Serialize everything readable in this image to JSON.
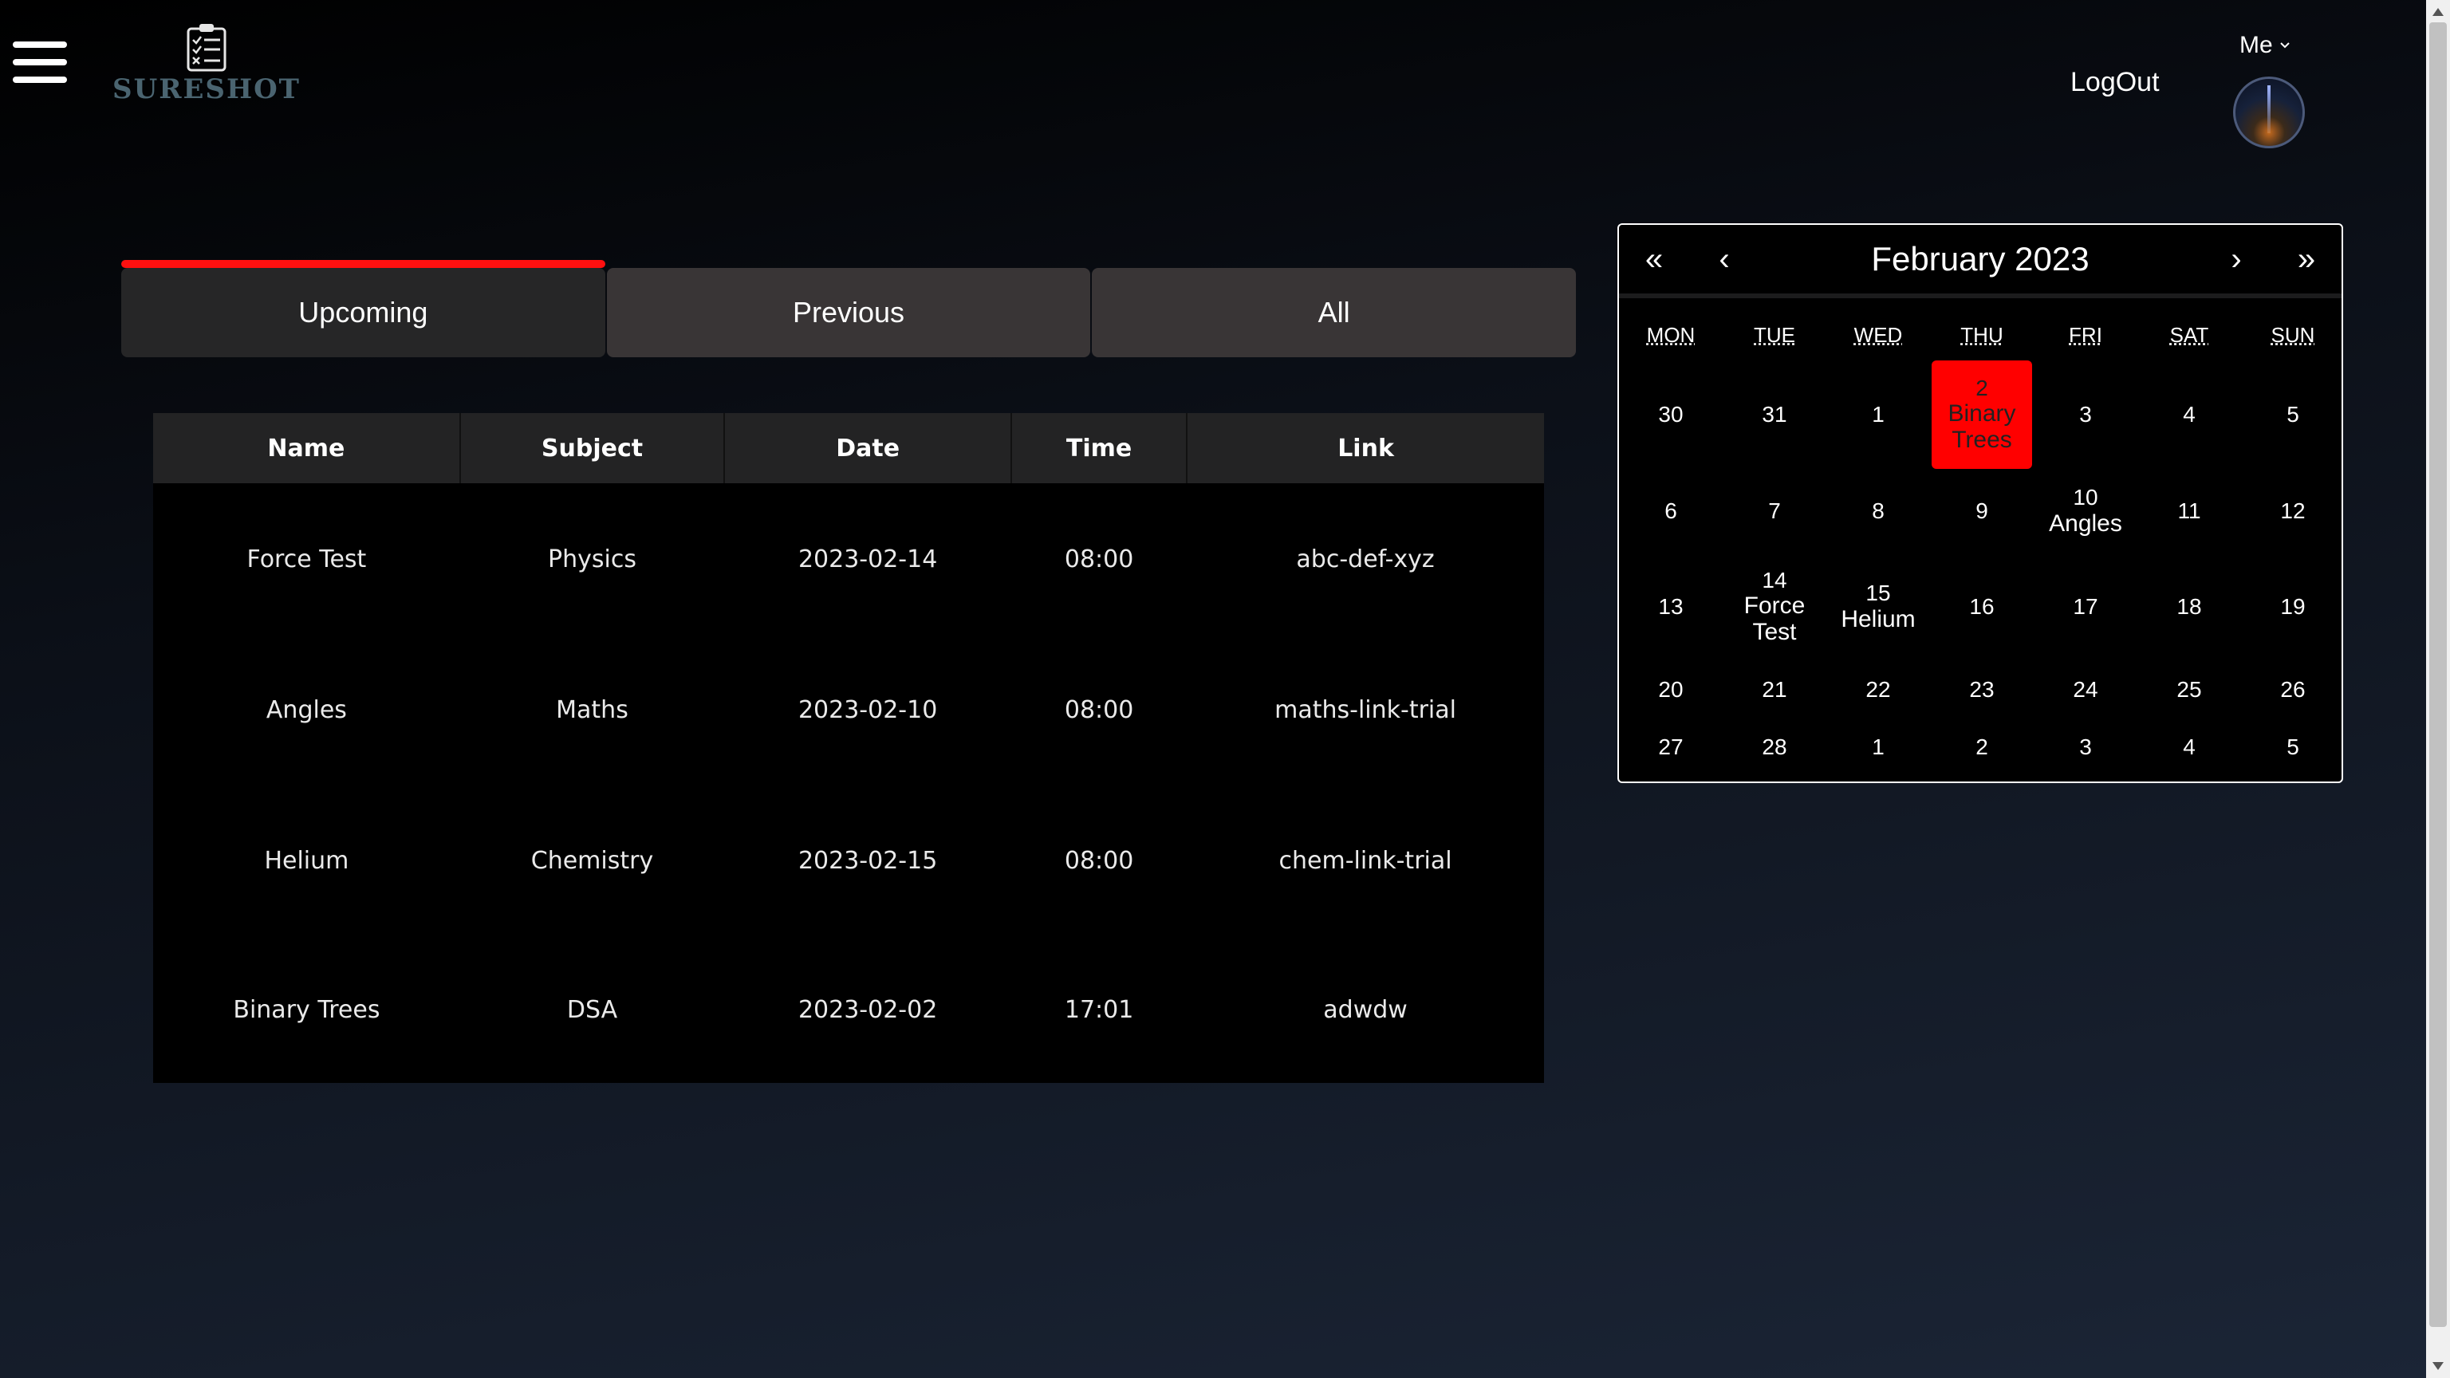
{
  "header": {
    "logo_text": "SURESHOT",
    "logout_label": "LogOut",
    "user_menu_label": "Me"
  },
  "tabs": [
    {
      "label": "Upcoming",
      "active": true
    },
    {
      "label": "Previous",
      "active": false
    },
    {
      "label": "All",
      "active": false
    }
  ],
  "table": {
    "columns": [
      "Name",
      "Subject",
      "Date",
      "Time",
      "Link"
    ],
    "rows": [
      [
        "Force Test",
        "Physics",
        "2023-02-14",
        "08:00",
        "abc-def-xyz"
      ],
      [
        "Angles",
        "Maths",
        "2023-02-10",
        "08:00",
        "maths-link-trial"
      ],
      [
        "Helium",
        "Chemistry",
        "2023-02-15",
        "08:00",
        "chem-link-trial"
      ],
      [
        "Binary Trees",
        "DSA",
        "2023-02-02",
        "17:01",
        "adwdw"
      ]
    ]
  },
  "calendar": {
    "nav": {
      "prev_year": "«",
      "prev_month": "‹",
      "next_month": "›",
      "next_year": "»"
    },
    "title": "February 2023",
    "weekdays": [
      "MON",
      "TUE",
      "WED",
      "THU",
      "FRI",
      "SAT",
      "SUN"
    ],
    "weeks": [
      [
        {
          "day": "30"
        },
        {
          "day": "31"
        },
        {
          "day": "1"
        },
        {
          "day": "2",
          "event": "Binary Trees",
          "highlight": true
        },
        {
          "day": "3"
        },
        {
          "day": "4"
        },
        {
          "day": "5"
        }
      ],
      [
        {
          "day": "6"
        },
        {
          "day": "7"
        },
        {
          "day": "8"
        },
        {
          "day": "9"
        },
        {
          "day": "10",
          "event": "Angles"
        },
        {
          "day": "11"
        },
        {
          "day": "12"
        }
      ],
      [
        {
          "day": "13"
        },
        {
          "day": "14",
          "event": "Force Test"
        },
        {
          "day": "15",
          "event": "Helium"
        },
        {
          "day": "16"
        },
        {
          "day": "17"
        },
        {
          "day": "18"
        },
        {
          "day": "19"
        }
      ],
      [
        {
          "day": "20"
        },
        {
          "day": "21"
        },
        {
          "day": "22"
        },
        {
          "day": "23"
        },
        {
          "day": "24"
        },
        {
          "day": "25"
        },
        {
          "day": "26"
        }
      ],
      [
        {
          "day": "27"
        },
        {
          "day": "28"
        },
        {
          "day": "1"
        },
        {
          "day": "2"
        },
        {
          "day": "3"
        },
        {
          "day": "4"
        },
        {
          "day": "5"
        }
      ]
    ],
    "highlight_color": "#ff0000"
  },
  "colors": {
    "accent": "#ff1010",
    "tab_bg": "#393536",
    "tab_active_bg": "#262627"
  }
}
